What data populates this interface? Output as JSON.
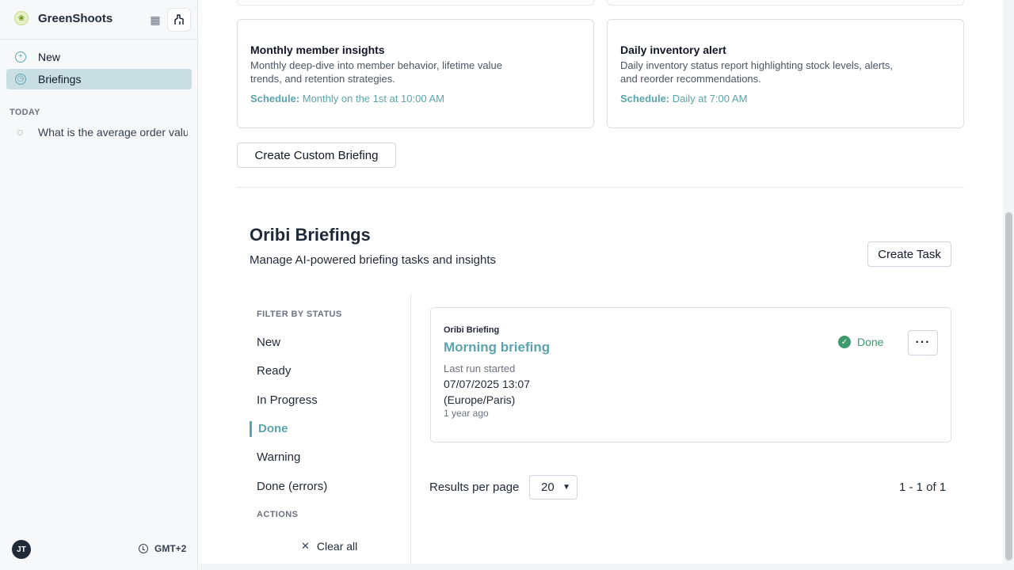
{
  "app": {
    "name": "GreenShoots"
  },
  "sidebar": {
    "nav": [
      {
        "label": "New",
        "icon": "plus-circle-icon"
      },
      {
        "label": "Briefings",
        "icon": "clock-icon"
      }
    ],
    "section_label": "TODAY",
    "history": [
      {
        "label": "What is the average order value"
      }
    ],
    "user_initials": "JT",
    "timezone": "GMT+2"
  },
  "templates": [
    {
      "title": "Monthly member insights",
      "description": "Monthly deep-dive into member behavior, lifetime value trends, and retention strategies.",
      "schedule_label": "Schedule:",
      "schedule_value": "Monthly on the 1st at 10:00 AM"
    },
    {
      "title": "Daily inventory alert",
      "description": "Daily inventory status report highlighting stock levels, alerts, and reorder recommendations.",
      "schedule_label": "Schedule:",
      "schedule_value": "Daily at 7:00 AM"
    }
  ],
  "actions": {
    "create_custom": "Create Custom Briefing",
    "create_task": "Create Task"
  },
  "briefings": {
    "title": "Oribi Briefings",
    "subtitle": "Manage AI-powered briefing tasks and insights",
    "filter_label": "FILTER BY STATUS",
    "filters": [
      "New",
      "Ready",
      "In Progress",
      "Done",
      "Warning",
      "Done (errors)"
    ],
    "active_filter": "Done",
    "actions_label": "ACTIONS",
    "clear_all": "Clear all",
    "items": [
      {
        "type": "Oribi Briefing",
        "title": "Morning briefing",
        "last_run_label": "Last run started",
        "last_run_date": "07/07/2025 13:07",
        "last_run_tz": "(Europe/Paris)",
        "relative": "1 year ago",
        "status": "Done"
      }
    ],
    "pagination": {
      "label": "Results per page",
      "per_page": "20",
      "range": "1 - 1 of 1"
    }
  },
  "colors": {
    "accent": "#5ba4ad",
    "success": "#3d9a6a",
    "active_nav": "#c9dfe4"
  }
}
